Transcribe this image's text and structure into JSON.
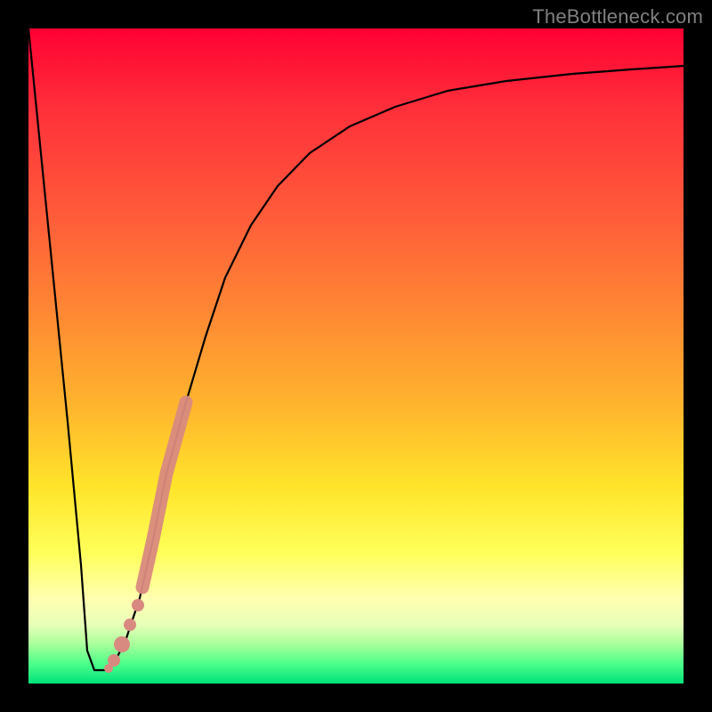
{
  "watermark": "TheBottleneck.com",
  "colors": {
    "frame": "#000000",
    "curve": "#000000",
    "highlight_stroke": "#c97a71",
    "highlight_fill": "#d98a80",
    "gradient_top": "#ff0033",
    "gradient_bottom": "#00e27a"
  },
  "chart_data": {
    "type": "line",
    "title": "",
    "xlabel": "",
    "ylabel": "",
    "xlim": [
      0,
      100
    ],
    "ylim": [
      0,
      100
    ],
    "grid": false,
    "legend": false,
    "annotations": [
      "TheBottleneck.com"
    ],
    "series": [
      {
        "name": "bottleneck-curve",
        "x": [
          0,
          3,
          6,
          8,
          9,
          10,
          12,
          13,
          15,
          17,
          19,
          21,
          24,
          27,
          30,
          34,
          38,
          43,
          49,
          56,
          64,
          73,
          83,
          92,
          100
        ],
        "y": [
          100,
          70,
          40,
          18,
          5,
          2,
          2,
          3,
          7,
          13,
          22,
          32,
          43,
          53,
          62,
          70,
          76,
          81,
          85,
          88,
          90.5,
          92,
          93,
          93.8,
          94.3
        ]
      }
    ],
    "highlight_segment": {
      "on_series": "bottleneck-curve",
      "x_start": 13,
      "x_end": 24,
      "style": "thick"
    },
    "highlight_dots": {
      "on_series": "bottleneck-curve",
      "points": [
        {
          "x": 15.5,
          "y": 9
        },
        {
          "x": 14.2,
          "y": 6
        },
        {
          "x": 13.0,
          "y": 3.5
        },
        {
          "x": 12.3,
          "y": 2.3
        }
      ]
    }
  }
}
